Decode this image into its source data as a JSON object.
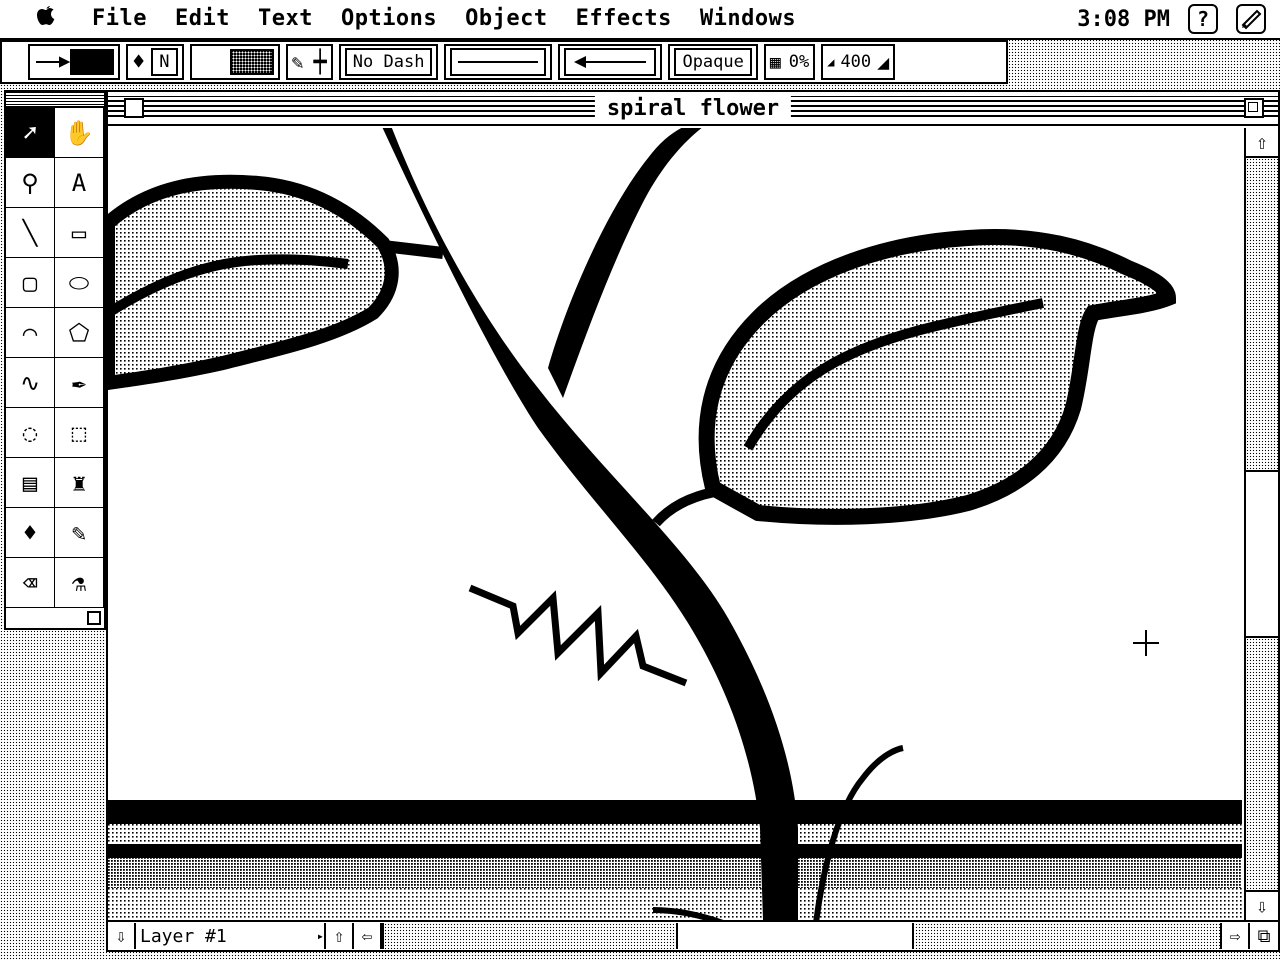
{
  "menubar": {
    "apple_icon": "apple-icon",
    "items": [
      "File",
      "Edit",
      "Text",
      "Options",
      "Object",
      "Effects",
      "Windows"
    ],
    "clock": "3:08 PM",
    "help_icon": "?"
  },
  "paintbar": {
    "fill_mode": "N",
    "dash": "No Dash",
    "mode": "Opaque",
    "percent": "0%",
    "zoom": "400"
  },
  "toolbox": {
    "tools": [
      {
        "name": "pointer-tool",
        "glyph": "➚",
        "selected": true
      },
      {
        "name": "hand-tool",
        "glyph": "✋"
      },
      {
        "name": "zoom-tool",
        "glyph": "⚲"
      },
      {
        "name": "text-tool",
        "glyph": "A"
      },
      {
        "name": "line-tool",
        "glyph": "╲"
      },
      {
        "name": "rectangle-tool",
        "glyph": "▭"
      },
      {
        "name": "rounded-rectangle-tool",
        "glyph": "▢"
      },
      {
        "name": "oval-tool",
        "glyph": "⬭"
      },
      {
        "name": "arc-tool",
        "glyph": "⌒"
      },
      {
        "name": "polygon-tool",
        "glyph": "⬠"
      },
      {
        "name": "freehand-tool",
        "glyph": "∿"
      },
      {
        "name": "pen-tool",
        "glyph": "✒"
      },
      {
        "name": "lasso-tool",
        "glyph": "◌"
      },
      {
        "name": "marquee-tool",
        "glyph": "⬚"
      },
      {
        "name": "spray-tool",
        "glyph": "▤"
      },
      {
        "name": "brush-tool",
        "glyph": "♜"
      },
      {
        "name": "paint-bucket-tool",
        "glyph": "♦"
      },
      {
        "name": "pencil-tool",
        "glyph": "✎"
      },
      {
        "name": "eraser-tool",
        "glyph": "⌫"
      },
      {
        "name": "eyedropper-tool",
        "glyph": "⚗"
      }
    ]
  },
  "document": {
    "title": "spiral flower",
    "layer": "Layer #1"
  }
}
